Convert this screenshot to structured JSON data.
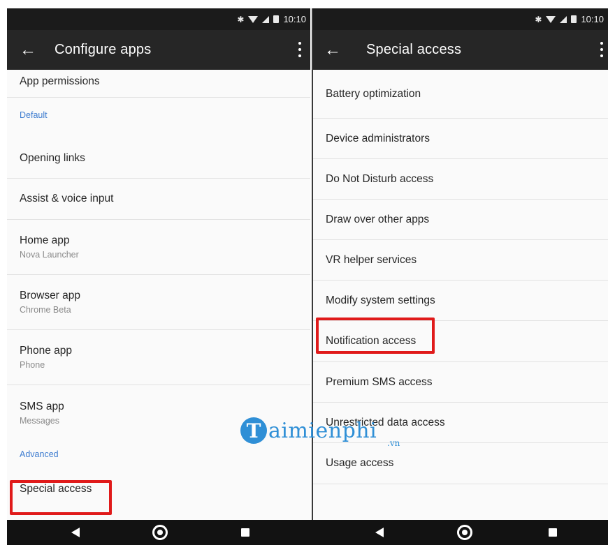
{
  "status_bar": {
    "time": "10:10"
  },
  "left_screen": {
    "title": "Configure apps",
    "items": [
      {
        "label": "App permissions"
      },
      {
        "section": "Default"
      },
      {
        "label": "Opening links"
      },
      {
        "label": "Assist & voice input"
      },
      {
        "label": "Home app",
        "sub": "Nova Launcher"
      },
      {
        "label": "Browser app",
        "sub": "Chrome Beta"
      },
      {
        "label": "Phone app",
        "sub": "Phone"
      },
      {
        "label": "SMS app",
        "sub": "Messages"
      },
      {
        "section": "Advanced"
      },
      {
        "label": "Special access",
        "highlighted": true
      }
    ]
  },
  "right_screen": {
    "title": "Special access",
    "items": [
      {
        "label": "Battery optimization"
      },
      {
        "label": "Device administrators"
      },
      {
        "label": "Do Not Disturb access"
      },
      {
        "label": "Draw over other apps"
      },
      {
        "label": "VR helper services"
      },
      {
        "label": "Modify system settings"
      },
      {
        "label": "Notification access",
        "highlighted": true
      },
      {
        "label": "Premium SMS access"
      },
      {
        "label": "Unrestricted data access"
      },
      {
        "label": "Usage access"
      }
    ]
  },
  "watermark": {
    "badge": "T",
    "text": "aimienphi",
    "sub": ".vn"
  },
  "icons": {
    "back": "arrow-back-icon",
    "more": "more-vert-icon",
    "nav_back": "triangle-back-icon",
    "nav_home": "circle-home-icon",
    "nav_recent": "square-recents-icon"
  },
  "colors": {
    "highlight": "#e01a1a",
    "section": "#3f7dd0",
    "appbar": "#262626",
    "watermark": "#2f8fd6"
  }
}
